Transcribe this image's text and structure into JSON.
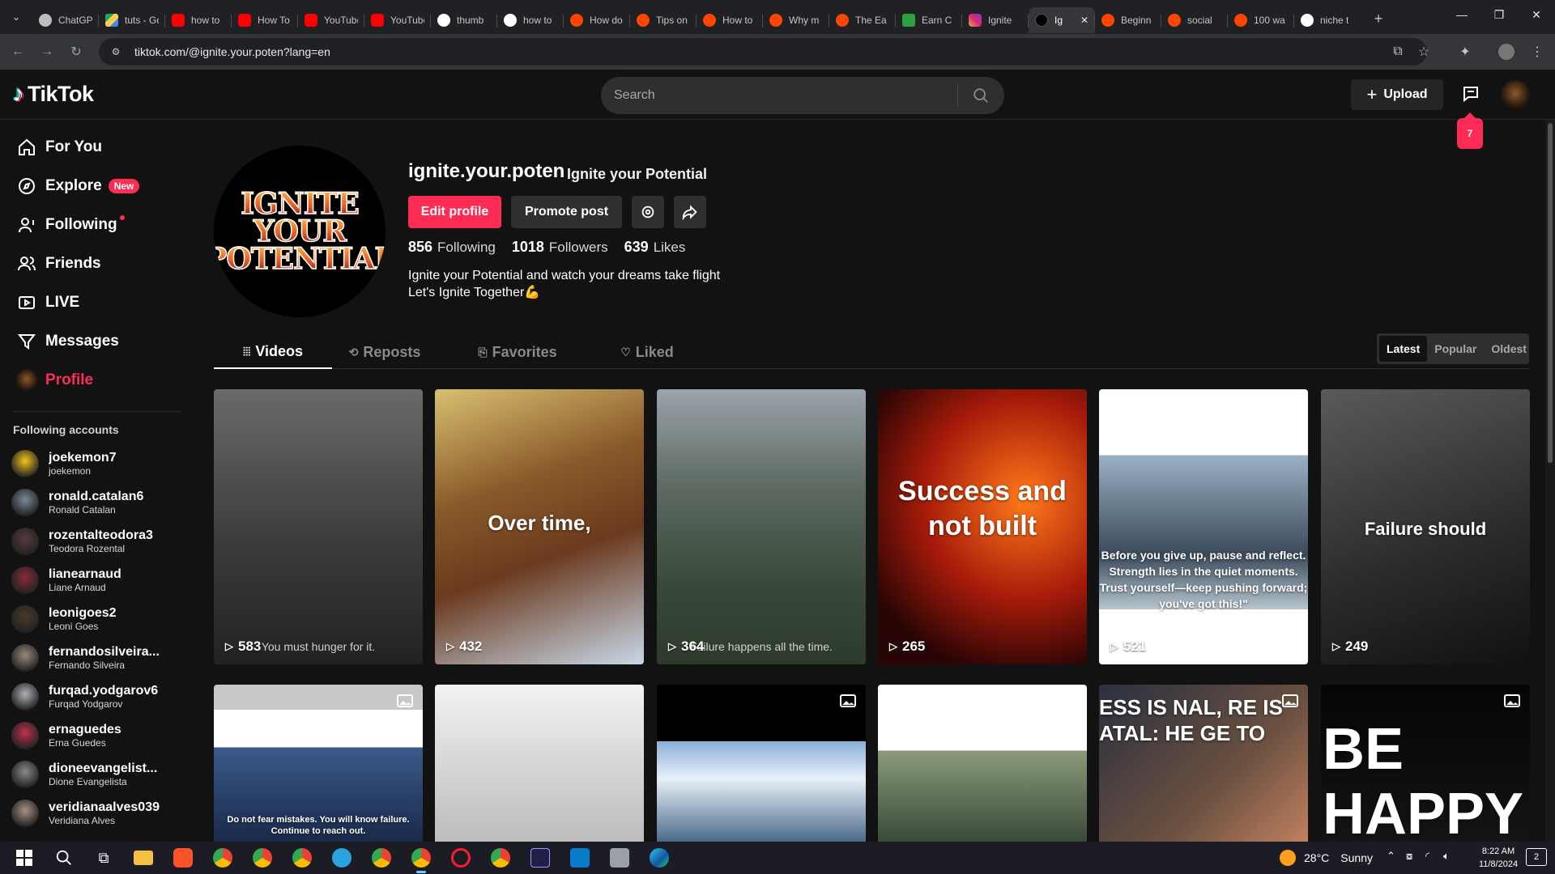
{
  "browser": {
    "tabs": [
      {
        "label": "ChatGPT",
        "favicon": "chatgpt"
      },
      {
        "label": "tuts - Google Drive",
        "favicon": "drive"
      },
      {
        "label": "how to",
        "favicon": "yt"
      },
      {
        "label": "How To",
        "favicon": "yt"
      },
      {
        "label": "YouTube",
        "favicon": "yt"
      },
      {
        "label": "YouTube",
        "favicon": "yt"
      },
      {
        "label": "thumb",
        "favicon": "google"
      },
      {
        "label": "how to",
        "favicon": "google"
      },
      {
        "label": "How do",
        "favicon": "reddit"
      },
      {
        "label": "Tips on",
        "favicon": "reddit"
      },
      {
        "label": "How to",
        "favicon": "reddit"
      },
      {
        "label": "Why m",
        "favicon": "reddit"
      },
      {
        "label": "The Ea",
        "favicon": "reddit"
      },
      {
        "label": "Earn C",
        "favicon": "earn"
      },
      {
        "label": "Ignite",
        "favicon": "ig"
      },
      {
        "label": "Ig",
        "favicon": "tiktok",
        "active": true
      },
      {
        "label": "Beginn",
        "favicon": "reddit"
      },
      {
        "label": "social",
        "favicon": "reddit"
      },
      {
        "label": "100 wa",
        "favicon": "reddit"
      },
      {
        "label": "niche t",
        "favicon": "google"
      }
    ],
    "url": "tiktok.com/@ignite.your.poten?lang=en"
  },
  "header": {
    "logo": "TikTok",
    "search_placeholder": "Search",
    "upload_label": "Upload",
    "inbox_badge": "7"
  },
  "sidebar": {
    "nav": [
      {
        "label": "For You",
        "icon": "home-icon"
      },
      {
        "label": "Explore",
        "icon": "compass-icon",
        "badge": "New"
      },
      {
        "label": "Following",
        "icon": "following-icon",
        "dot": true
      },
      {
        "label": "Friends",
        "icon": "friends-icon"
      },
      {
        "label": "LIVE",
        "icon": "live-icon"
      },
      {
        "label": "Messages",
        "icon": "messages-icon"
      },
      {
        "label": "Profile",
        "icon": "profile-avatar",
        "active": true
      }
    ],
    "following_title": "Following accounts",
    "accounts": [
      {
        "username": "joekemon7",
        "name": "joekemon",
        "color": "#f5c518"
      },
      {
        "username": "ronald.catalan6",
        "name": "Ronald Catalan",
        "color": "#7a8a99"
      },
      {
        "username": "rozentalteodora3",
        "name": "Teodora Rozental",
        "color": "#5a3a3a"
      },
      {
        "username": "lianearnaud",
        "name": "Liane Arnaud",
        "color": "#8a2a3a"
      },
      {
        "username": "leonigoes2",
        "name": "Leoni Goes",
        "color": "#4a3a2a"
      },
      {
        "username": "fernandosilveira...",
        "name": "Fernando Silveira",
        "color": "#9a8a7a"
      },
      {
        "username": "furqad.yodgarov6",
        "name": "Furqad Yodgarov",
        "color": "#b0b0b8"
      },
      {
        "username": "ernaguedes",
        "name": "Erna Guedes",
        "color": "#c03050"
      },
      {
        "username": "dioneevangelist...",
        "name": "Dione Evangelista",
        "color": "#8a8a8a"
      },
      {
        "username": "veridianaalves039",
        "name": "Veridiana Alves",
        "color": "#a89080"
      }
    ]
  },
  "profile": {
    "avatar_text": [
      "IGNITE",
      "YOUR",
      "POTENTIAL"
    ],
    "username": "ignite.your.poten",
    "nickname": "Ignite your Potential",
    "edit_label": "Edit profile",
    "promote_label": "Promote post",
    "stats": [
      {
        "num": "856",
        "label": "Following"
      },
      {
        "num": "1018",
        "label": "Followers"
      },
      {
        "num": "639",
        "label": "Likes"
      }
    ],
    "bio_line1": "Ignite your Potential and watch your dreams take flight",
    "bio_line2": "Let's Ignite Together💪"
  },
  "tabs": [
    {
      "label": "Videos",
      "icon": "grid-icon",
      "active": true
    },
    {
      "label": "Reposts",
      "icon": "repost-icon"
    },
    {
      "label": "Favorites",
      "icon": "bookmark-icon"
    },
    {
      "label": "Liked",
      "icon": "heart-icon"
    }
  ],
  "sort": [
    "Latest",
    "Popular",
    "Oldest"
  ],
  "videos": [
    {
      "views": "583",
      "caption": "You must hunger for it."
    },
    {
      "views": "432",
      "overlay": "Over time,"
    },
    {
      "views": "364",
      "caption": "Failure happens all the time."
    },
    {
      "views": "265",
      "overlay": "Success and not built"
    },
    {
      "views": "521",
      "overlay": "Before you give up, pause and reflect. Strength lies in the quiet moments. Trust yourself—keep pushing forward; you've got this!\""
    },
    {
      "views": "249",
      "overlay": "Failure should"
    }
  ],
  "videos_row2": [
    {
      "overlay": "Do not fear mistakes. You will know failure. Continue to reach out.",
      "photo": true
    },
    {
      "overlay": ""
    },
    {
      "overlay": "",
      "photo": true
    },
    {
      "overlay": ""
    },
    {
      "overlay": "ESS IS NAL, RE IS ATAL: HE GE TO",
      "photo": true
    },
    {
      "overlay": "BE HAPPY",
      "photo": true
    }
  ],
  "taskbar": {
    "weather_temp": "28°C",
    "weather_text": "Sunny",
    "time": "8:22 AM",
    "date": "11/8/2024",
    "notif_count": "2"
  }
}
